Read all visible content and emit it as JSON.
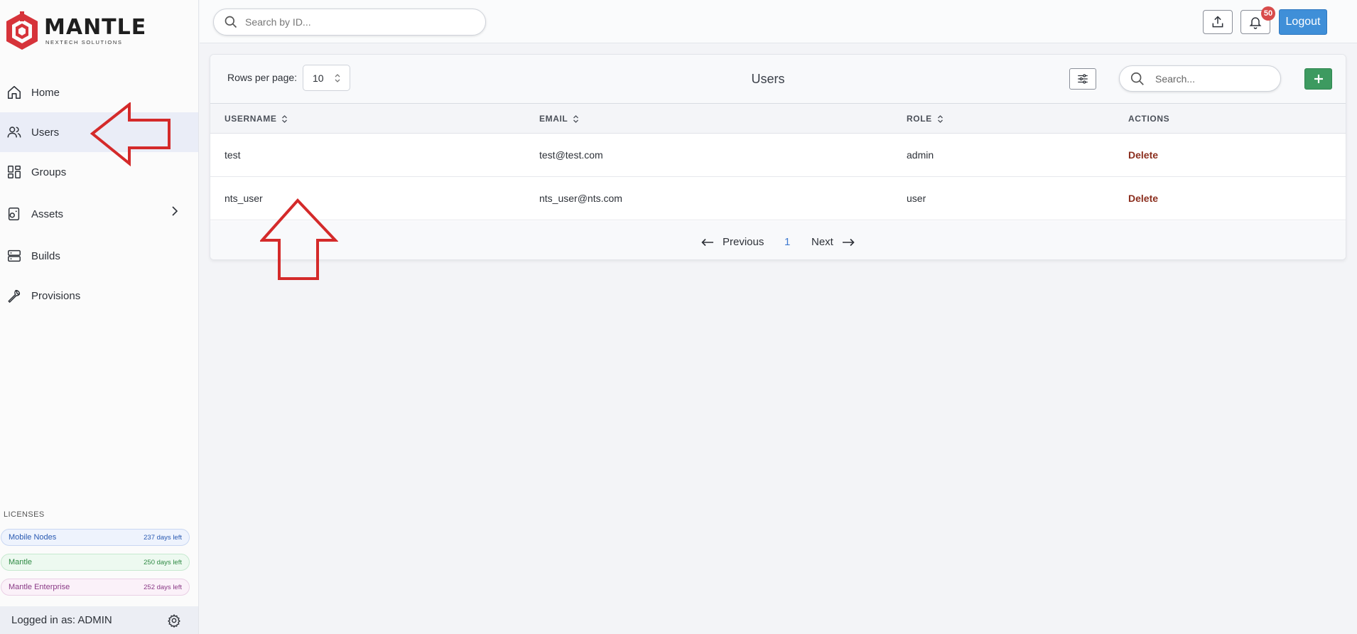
{
  "brand": {
    "name": "MANTLE",
    "tagline": "NEXTECH SOLUTIONS",
    "color": "#d6333a"
  },
  "sidebar": {
    "items": [
      {
        "label": "Home",
        "icon": "home-icon"
      },
      {
        "label": "Users",
        "icon": "users-icon",
        "active": true
      },
      {
        "label": "Groups",
        "icon": "grid-icon"
      },
      {
        "label": "Assets",
        "icon": "assets-icon",
        "has_submenu": true
      },
      {
        "label": "Builds",
        "icon": "server-icon"
      },
      {
        "label": "Provisions",
        "icon": "wrench-icon"
      }
    ],
    "licenses_title": "LICENSES",
    "licenses": [
      {
        "name": "Mobile Nodes",
        "days": "237 days left",
        "color": "#2a5ab2"
      },
      {
        "name": "Mantle",
        "days": "250 days left",
        "color": "#2f8a44"
      },
      {
        "name": "Mantle Enterprise",
        "days": "252 days left",
        "color": "#8a3a86"
      }
    ],
    "logged_in": "Logged in as: ADMIN"
  },
  "topbar": {
    "search_placeholder": "Search by ID...",
    "notification_count": "50",
    "logout_label": "Logout"
  },
  "panel": {
    "rows_label": "Rows per page:",
    "rows_value": "10",
    "title": "Users",
    "search_placeholder": "Search...",
    "columns": [
      "USERNAME",
      "EMAIL",
      "ROLE",
      "ACTIONS"
    ],
    "rows": [
      {
        "username": "test",
        "email": "test@test.com",
        "role": "admin",
        "action": "Delete"
      },
      {
        "username": "nts_user",
        "email": "nts_user@nts.com",
        "role": "user",
        "action": "Delete"
      }
    ],
    "pagination": {
      "previous": "Previous",
      "page": "1",
      "next": "Next"
    }
  },
  "colors": {
    "accent": "#3f8fd8",
    "add_button": "#3d9a60",
    "delete": "#8b2e1e",
    "annotation": "#d42a2a"
  }
}
